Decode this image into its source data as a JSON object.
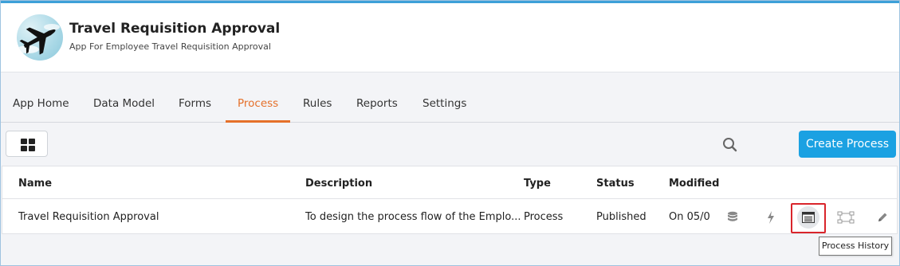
{
  "app": {
    "title": "Travel Requisition Approval",
    "subtitle": "App For Employee Travel Requisition Approval",
    "logo_icon": "airplane-icon"
  },
  "tabs": [
    {
      "label": "App Home",
      "active": false
    },
    {
      "label": "Data Model",
      "active": false
    },
    {
      "label": "Forms",
      "active": false
    },
    {
      "label": "Process",
      "active": true
    },
    {
      "label": "Rules",
      "active": false
    },
    {
      "label": "Reports",
      "active": false
    },
    {
      "label": "Settings",
      "active": false
    }
  ],
  "toolbar": {
    "view_toggle_icon": "grid-view-icon",
    "search_icon": "search-icon",
    "create_label": "Create Process"
  },
  "table": {
    "columns": [
      "Name",
      "Description",
      "Type",
      "Status",
      "Modified"
    ],
    "rows": [
      {
        "name": "Travel Requisition Approval",
        "description": "To design the process flow of the Emplo...",
        "type": "Process",
        "status": "Published",
        "modified": "On 05/0",
        "actions": [
          "database-icon",
          "lightning-icon",
          "process-history-icon",
          "diagram-icon",
          "pencil-icon"
        ]
      }
    ]
  },
  "tooltip": "Process History",
  "colors": {
    "accent_tab": "#e5702a",
    "primary_button": "#1ba1e2",
    "highlight_box": "#d9252b"
  }
}
